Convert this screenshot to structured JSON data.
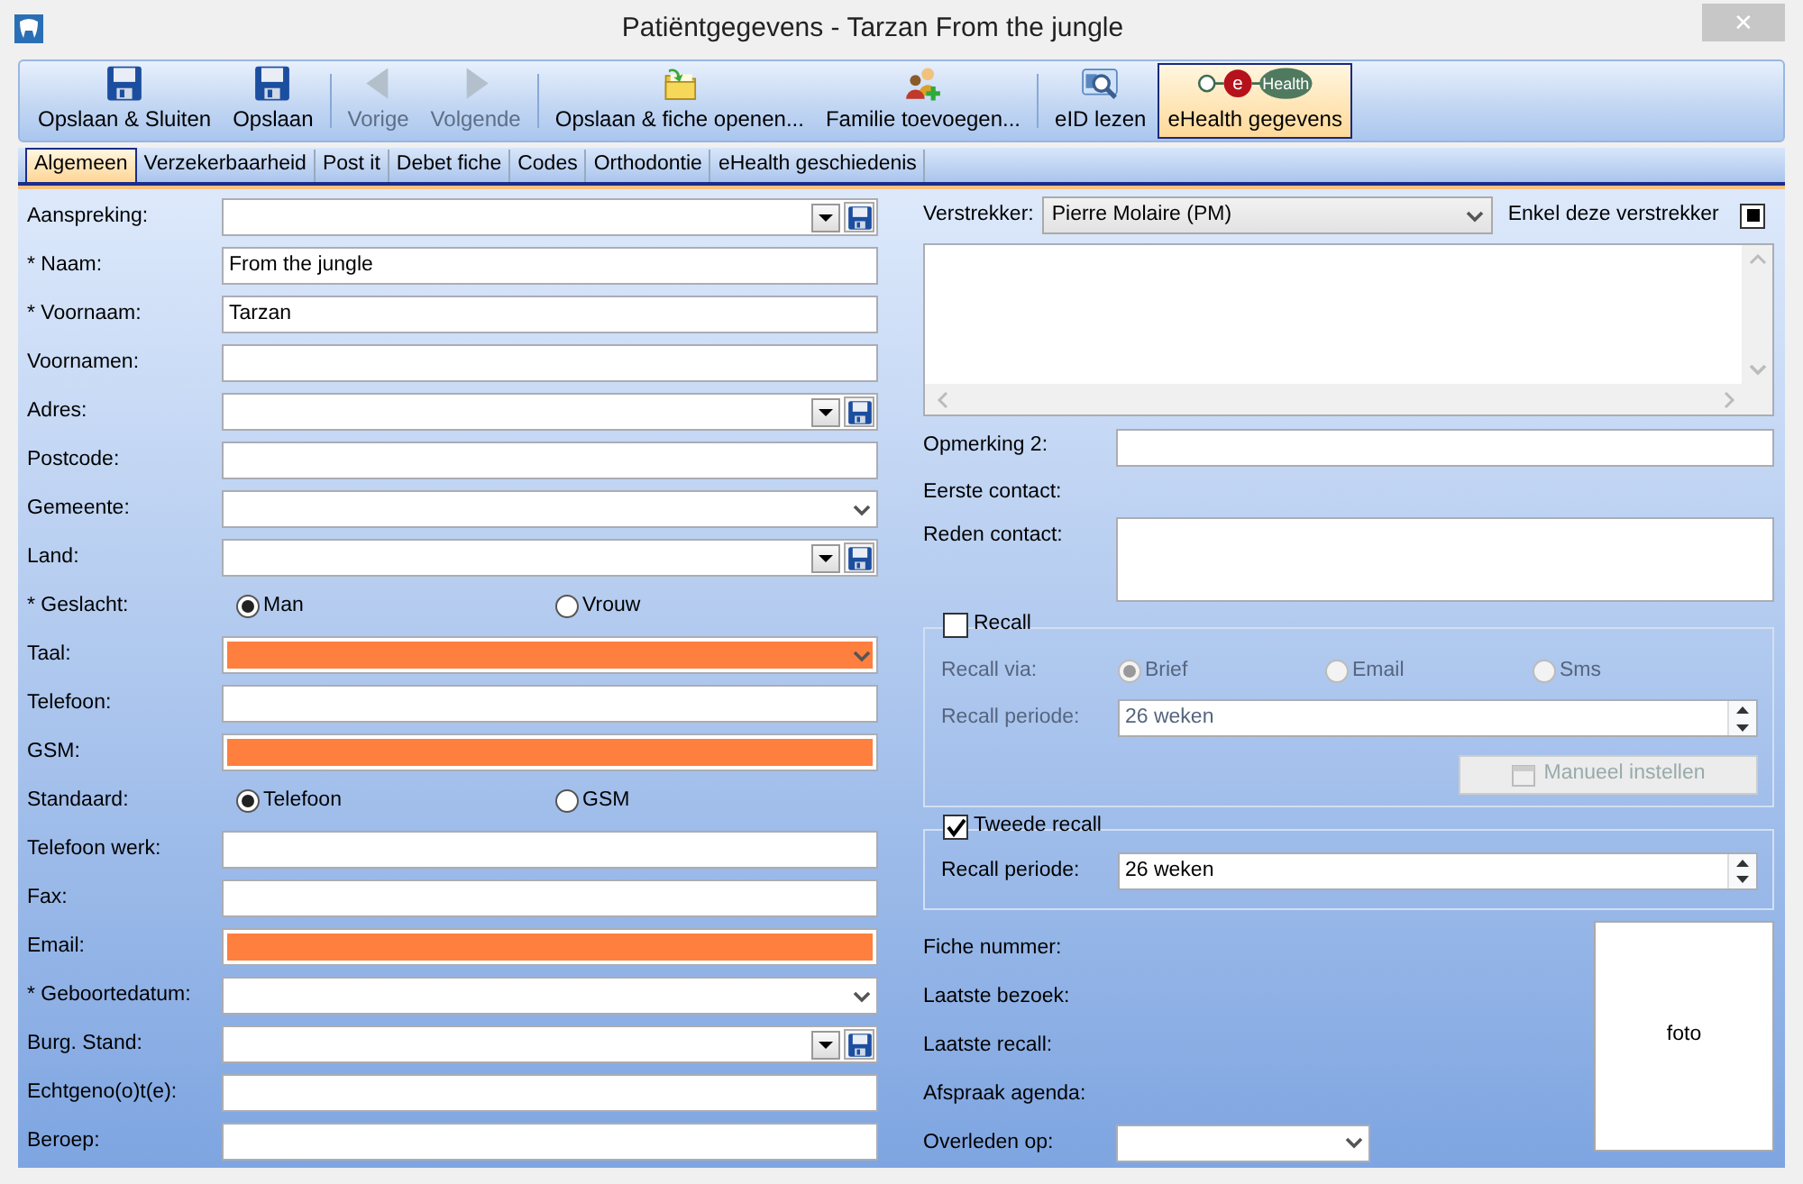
{
  "window": {
    "title": "Patiëntgegevens - Tarzan From the jungle",
    "close": "✕"
  },
  "toolbar": {
    "groups": [
      [
        {
          "label": "Opslaan & Sluiten",
          "disabled": false,
          "selected": false
        },
        {
          "label": "Opslaan",
          "disabled": false,
          "selected": false
        }
      ],
      [
        {
          "label": "Vorige",
          "disabled": true,
          "selected": false
        },
        {
          "label": "Volgende",
          "disabled": true,
          "selected": false
        }
      ],
      [
        {
          "label": "Opslaan & fiche openen...",
          "disabled": false,
          "selected": false
        },
        {
          "label": "Familie toevoegen...",
          "disabled": false,
          "selected": false
        }
      ],
      [
        {
          "label": "eID lezen",
          "disabled": false,
          "selected": false
        },
        {
          "label": "eHealth gegevens",
          "disabled": false,
          "selected": true,
          "logo_letter": "e",
          "logo_word": "Health"
        }
      ]
    ]
  },
  "tabs": [
    {
      "label": "Algemeen",
      "selected": true
    },
    {
      "label": "Verzekerbaarheid",
      "selected": false
    },
    {
      "label": "Post it",
      "selected": false
    },
    {
      "label": "Debet fiche",
      "selected": false
    },
    {
      "label": "Codes",
      "selected": false
    },
    {
      "label": "Orthodontie",
      "selected": false
    },
    {
      "label": "eHealth geschiedenis",
      "selected": false
    }
  ],
  "left": [
    {
      "kind": "combo_save",
      "label": "Aanspreking:",
      "highlight": false
    },
    {
      "kind": "text",
      "label": "* Naam:",
      "value": "From the jungle",
      "highlight": false
    },
    {
      "kind": "text",
      "label": "* Voornaam:",
      "value": "Tarzan",
      "highlight": false
    },
    {
      "kind": "text",
      "label": "Voornamen:",
      "highlight": false
    },
    {
      "kind": "combo_save",
      "label": "Adres:",
      "highlight": false
    },
    {
      "kind": "text",
      "label": "Postcode:",
      "highlight": false
    },
    {
      "kind": "combo",
      "label": "Gemeente:",
      "highlight": false
    },
    {
      "kind": "combo_save",
      "label": "Land:",
      "highlight": false
    },
    {
      "kind": "radio",
      "label": "* Geslacht:",
      "options": [
        {
          "label": "Man",
          "selected": true
        },
        {
          "label": "Vrouw",
          "selected": false
        }
      ]
    },
    {
      "kind": "combo",
      "label": "Taal:",
      "highlight": true
    },
    {
      "kind": "text",
      "label": "Telefoon:",
      "highlight": false
    },
    {
      "kind": "text",
      "label": "GSM:",
      "highlight": true
    },
    {
      "kind": "radio",
      "label": "Standaard:",
      "options": [
        {
          "label": "Telefoon",
          "selected": true
        },
        {
          "label": "GSM",
          "selected": false
        }
      ]
    },
    {
      "kind": "text",
      "label": "Telefoon werk:",
      "highlight": false
    },
    {
      "kind": "text",
      "label": "Fax:",
      "highlight": false
    },
    {
      "kind": "text",
      "label": "Email:",
      "highlight": true
    },
    {
      "kind": "combo",
      "label": "* Geboortedatum:",
      "highlight": false
    },
    {
      "kind": "combo_save",
      "label": "Burg. Stand:",
      "highlight": false
    },
    {
      "kind": "text",
      "label": "Echtgeno(o)t(e):",
      "highlight": false
    },
    {
      "kind": "text",
      "label": "Beroep:",
      "highlight": false
    }
  ],
  "right": {
    "provider": {
      "label": "Verstrekker:",
      "value": "Pierre Molaire (PM)"
    },
    "only_this_provider": {
      "label": "Enkel deze verstrekker",
      "checked": true
    },
    "remark2": {
      "label": "Opmerking 2:"
    },
    "first_contact": {
      "label": "Eerste contact:"
    },
    "contact_reason": {
      "label": "Reden contact:"
    },
    "recall": {
      "label": "Recall",
      "checked": false,
      "disabled": true,
      "via_label": "Recall via:",
      "via_options": [
        {
          "label": "Brief",
          "selected": true
        },
        {
          "label": "Email",
          "selected": false
        },
        {
          "label": "Sms",
          "selected": false
        }
      ],
      "period_label": "Recall periode:",
      "period_value": "26 weken",
      "manual_button": "Manueel instellen"
    },
    "second_recall": {
      "label": "Tweede recall",
      "checked": true,
      "period_label": "Recall periode:",
      "period_value": "26 weken"
    },
    "info": [
      {
        "kind": "text",
        "label": "Fiche nummer:"
      },
      {
        "kind": "text",
        "label": "Laatste bezoek:"
      },
      {
        "kind": "text",
        "label": "Laatste recall:"
      },
      {
        "kind": "text",
        "label": "Afspraak agenda:"
      },
      {
        "kind": "date",
        "label": "Overleden op:"
      }
    ],
    "photo": {
      "label": "foto"
    }
  }
}
